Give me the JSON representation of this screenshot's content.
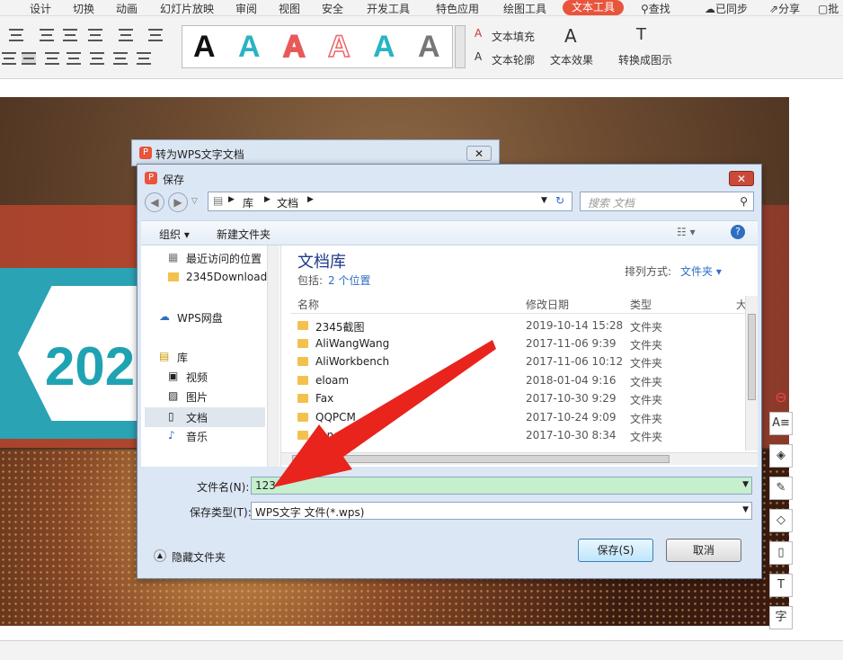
{
  "menubar": {
    "items": [
      "设计",
      "切换",
      "动画",
      "幻灯片放映",
      "审阅",
      "视图",
      "安全",
      "开发工具",
      "特色应用",
      "绘图工具",
      "文本工具",
      "查找"
    ],
    "right": [
      "已同步",
      "分享",
      "批"
    ]
  },
  "ribbon": {
    "text_fill": "文本填充",
    "text_outline": "文本轮廓",
    "text_effect": "文本效果",
    "convert": "转换成图示",
    "gallery_letter": "A"
  },
  "slide": {
    "year": "202"
  },
  "back_dialog": {
    "title": "转为WPS文字文档"
  },
  "dialog": {
    "title": "保存",
    "breadcrumb": [
      "库",
      "文档"
    ],
    "search_placeholder": "搜索 文档",
    "toolbar": {
      "organize": "组织",
      "new_folder": "新建文件夹"
    },
    "nav": {
      "recent": "最近访问的位置",
      "downloads": "2345Download",
      "wps_cloud": "WPS网盘",
      "library": "库",
      "video": "视频",
      "pictures": "图片",
      "documents": "文档",
      "music": "音乐"
    },
    "library_title": "文档库",
    "includes": "包括:",
    "locations": "2 个位置",
    "sort_label": "排列方式:",
    "sort_value": "文件夹",
    "columns": {
      "name": "名称",
      "date": "修改日期",
      "type": "类型",
      "size": "大"
    },
    "files": [
      {
        "name": "2345截图",
        "date": "2019-10-14 15:28",
        "type": "文件夹"
      },
      {
        "name": "AliWangWang",
        "date": "2017-11-06 9:39",
        "type": "文件夹"
      },
      {
        "name": "AliWorkbench",
        "date": "2017-11-06 10:12",
        "type": "文件夹"
      },
      {
        "name": "eloam",
        "date": "2018-01-04 9:16",
        "type": "文件夹"
      },
      {
        "name": "Fax",
        "date": "2017-10-30 9:29",
        "type": "文件夹"
      },
      {
        "name": "QQPCM",
        "date": "2017-10-24 9:09",
        "type": "文件夹"
      },
      {
        "name": "Tencent",
        "date": "2017-10-30 8:34",
        "type": "文件夹"
      }
    ],
    "filename_label": "文件名(N):",
    "filename_value": "123",
    "filetype_label": "保存类型(T):",
    "filetype_value": "WPS文字 文件(*.wps)",
    "hide_folders": "隐藏文件夹",
    "save": "保存(S)",
    "cancel": "取消"
  }
}
